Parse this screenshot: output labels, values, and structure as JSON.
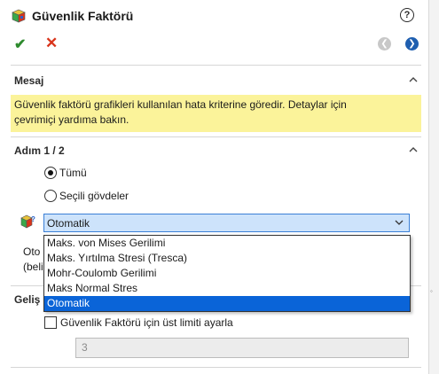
{
  "window": {
    "title": "Güvenlik Faktörü",
    "help_icon": "help-icon",
    "help_glyph": "?"
  },
  "toolbar": {
    "ok_glyph": "✔",
    "cancel_glyph": "✕",
    "back_glyph": "❮",
    "forward_glyph": "❯"
  },
  "message_section": {
    "header": "Mesaj",
    "text_line1": "Güvenlik faktörü grafikleri kullanılan hata kriterine göredir. Detaylar için",
    "text_line2": "çevrimiçi yardıma bakın.",
    "bg_color": "#fbf39a"
  },
  "step_section": {
    "header": "Adım 1 / 2",
    "radio_all": "Tümü",
    "radio_selected_bodies": "Seçili gövdeler",
    "selected_radio": "Tümü",
    "criterion_value": "Otomatik",
    "partial_line1": "Oto",
    "partial_line2": "(beli"
  },
  "criterion_dropdown": {
    "options": [
      "Maks. von Mises Gerilimi",
      "Maks. Yırtılma Stresi (Tresca)",
      "Mohr-Coulomb Gerilimi",
      "Maks Normal Stres",
      "Otomatik"
    ],
    "selected": "Otomatik",
    "highlight_color": "#0a64d8"
  },
  "advanced_section": {
    "header_partial": "Geliş",
    "checkbox_label": "Güvenlik Faktörü için üst limiti ayarla",
    "checkbox_checked": false,
    "limit_value": "3"
  }
}
